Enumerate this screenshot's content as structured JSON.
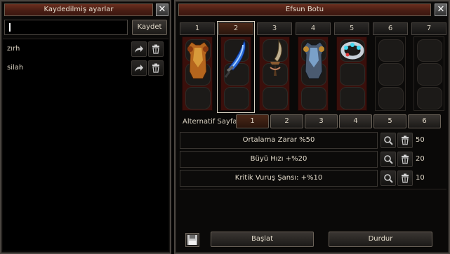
{
  "saved_window": {
    "title": "Kaydedilmiş ayarlar",
    "close_label": "✕",
    "search_value": "",
    "save_label": "Kaydet",
    "items": [
      {
        "name": "zırh"
      },
      {
        "name": "silah"
      }
    ]
  },
  "bonus_window": {
    "title": "Efsun Botu",
    "close_label": "✕",
    "slots": [
      {
        "number": "1",
        "item": "armor"
      },
      {
        "number": "2",
        "item": "sword",
        "selected": true
      },
      {
        "number": "3",
        "item": "dagger"
      },
      {
        "number": "4",
        "item": "armor-blue"
      },
      {
        "number": "5",
        "item": "bracelet"
      },
      {
        "number": "6",
        "item": null
      },
      {
        "number": "7",
        "item": null
      }
    ],
    "alt_page_label": "Alternatif Sayfa:",
    "alt_pages": [
      "1",
      "2",
      "3",
      "4",
      "5",
      "6"
    ],
    "active_alt_page": "1",
    "bonuses": [
      {
        "label": "Ortalama Zarar %50",
        "value": "50"
      },
      {
        "label": "Büyü Hızı +%20",
        "value": "20"
      },
      {
        "label": "Kritik Vuruş Şansı: +%10",
        "value": "10"
      }
    ],
    "start_label": "Başlat",
    "stop_label": "Durdur"
  },
  "colors": {
    "title_bar": "#5a261a",
    "slot_panel": "#3a0f0b",
    "active_tab": "#4a2818"
  },
  "icons": [
    "close-icon",
    "share-icon",
    "trash-icon",
    "search-icon",
    "floppy-disk-icon"
  ]
}
